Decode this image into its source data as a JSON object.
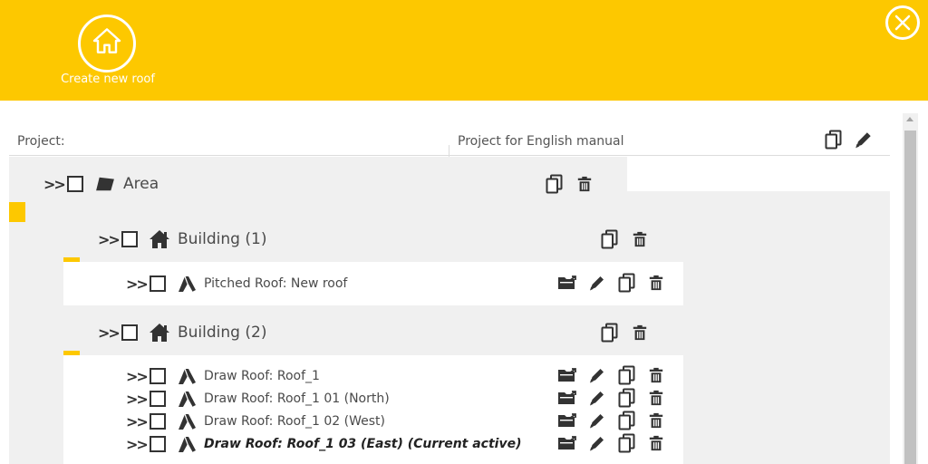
{
  "header": {
    "create_label": "Create new roof",
    "home_icon": "house-icon",
    "close_icon": "close-circle-icon",
    "accent": "#fdc800"
  },
  "project": {
    "label": "Project:",
    "value": "Project for English manual"
  },
  "tree": {
    "area": {
      "label": "Area"
    },
    "buildings": [
      {
        "label": "Building (1)",
        "roofs": [
          {
            "label": "Pitched Roof: New roof",
            "active": false
          }
        ]
      },
      {
        "label": "Building (2)",
        "roofs": [
          {
            "label": "Draw Roof: Roof_1",
            "active": false
          },
          {
            "label": "Draw Roof: Roof_1 01 (North)",
            "active": false
          },
          {
            "label": "Draw Roof: Roof_1 02 (West)",
            "active": false
          },
          {
            "label": "Draw Roof: Roof_1 03 (East) (Current active)",
            "active": true
          }
        ]
      }
    ]
  }
}
